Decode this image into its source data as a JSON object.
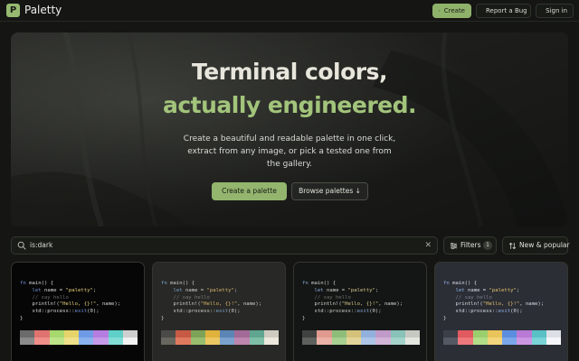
{
  "header": {
    "brand": "Paletty",
    "logo_letter": "P",
    "create_label": "Create",
    "report_label": "Report a Bug",
    "signin_label": "Sign in"
  },
  "hero": {
    "title_line1": "Terminal colors,",
    "title_line2": "actually engineered.",
    "subtitle": "Create a beautiful and readable palette in one click, extract from any image, or pick a tested one from the gallery.",
    "primary_cta": "Create a palette",
    "secondary_cta": "Browse palettes ↓"
  },
  "search": {
    "value": "is:dark"
  },
  "filters": {
    "label": "Filters",
    "count": "1"
  },
  "sort": {
    "label": "New & popular"
  },
  "code_sample": {
    "line1": "fn main() {",
    "line2": "    let name = \"paletty\";",
    "line3": "    // say hello",
    "line4": "    println!(\"Hello, {}!\", name);",
    "line5": "    std::process::exit(0);",
    "line6": "}"
  },
  "colors": {
    "accent": "#97b970",
    "background": "#151614"
  },
  "cards": [
    {
      "bg": "#060606",
      "fg": "#d8d8d8",
      "kw": "#6f8fd6",
      "str": "#e8d27a",
      "com": "#6a6a6a",
      "swatches_row1": [
        "#6b6b6b",
        "#e0736f",
        "#a6d86e",
        "#e6d46a",
        "#6f9be6",
        "#b57de0",
        "#5fd0c9",
        "#cfcfcf"
      ],
      "swatches_row2": [
        "#8a8a8a",
        "#ee8f8a",
        "#bde489",
        "#eee08a",
        "#8ab2ee",
        "#c69ae8",
        "#82dcd6",
        "#f2f2f2"
      ]
    },
    {
      "bg": "#282826",
      "fg": "#d2d0c8",
      "kw": "#7ba2c9",
      "str": "#d9b86a",
      "com": "#7a7a72",
      "swatches_row1": [
        "#4a4a47",
        "#c65a44",
        "#7ea257",
        "#e0b23c",
        "#5a85b5",
        "#a26a96",
        "#5fa58f",
        "#cfcbc1"
      ],
      "swatches_row2": [
        "#67675f",
        "#e07a5e",
        "#98bd6f",
        "#ecc863",
        "#7ba2cd",
        "#bc86ae",
        "#7fbfa8",
        "#ece8dd"
      ]
    },
    {
      "bg": "#141615",
      "fg": "#cfd2cc",
      "kw": "#88a8d8",
      "str": "#d8c88a",
      "com": "#6d716b",
      "swatches_row1": [
        "#3f4240",
        "#e09a8e",
        "#8ebd7a",
        "#d4c27a",
        "#92b0dc",
        "#c09ac8",
        "#88c2b8",
        "#c6c9c2"
      ],
      "swatches_row2": [
        "#5d615d",
        "#eab1a6",
        "#a7d091",
        "#e2d499",
        "#adc6e8",
        "#d2b4d8",
        "#a3d3ca",
        "#e3e6df"
      ]
    },
    {
      "bg": "#2b2e35",
      "fg": "#d9dde6",
      "kw": "#8fb0ea",
      "str": "#e6c46c",
      "com": "#7b8090",
      "swatches_row1": [
        "#3b3f47",
        "#e05a5f",
        "#9bcf6e",
        "#e9c45a",
        "#5c8ee0",
        "#b97ad6",
        "#59c1c6",
        "#dcdfe6"
      ],
      "swatches_row2": [
        "#545964",
        "#ee787c",
        "#b2de88",
        "#f2d57c",
        "#7ba6ea",
        "#cc97e2",
        "#7ad3d7",
        "#f4f6fa"
      ]
    }
  ]
}
